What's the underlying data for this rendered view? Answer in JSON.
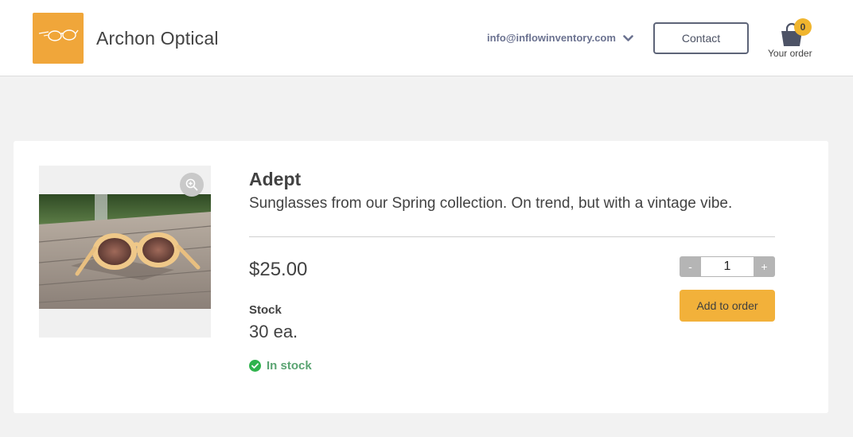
{
  "header": {
    "brand_name": "Archon Optical",
    "account_email": "info@inflowinventory.com",
    "contact_label": "Contact",
    "cart_count": "0",
    "cart_label": "Your order"
  },
  "product": {
    "name": "Adept",
    "description": "Sunglasses from our Spring collection. On trend, but with a vintage vibe.",
    "price": "$25.00",
    "stock_label": "Stock",
    "stock_quantity": "30 ea.",
    "availability": "In stock",
    "quantity_value": "1",
    "decrement_label": "-",
    "increment_label": "+",
    "add_to_order_label": "Add to order"
  },
  "icons": {
    "logo": "glasses-logo-icon",
    "account_dropdown": "chevron-down-icon",
    "cart": "shopping-bag-icon",
    "zoom": "zoom-in-icon",
    "availability": "check-circle-icon"
  },
  "colors": {
    "brand_accent": "#f0a63a",
    "button_accent": "#f2b13a",
    "in_stock": "#5aa472",
    "account_text": "#6b7290"
  }
}
